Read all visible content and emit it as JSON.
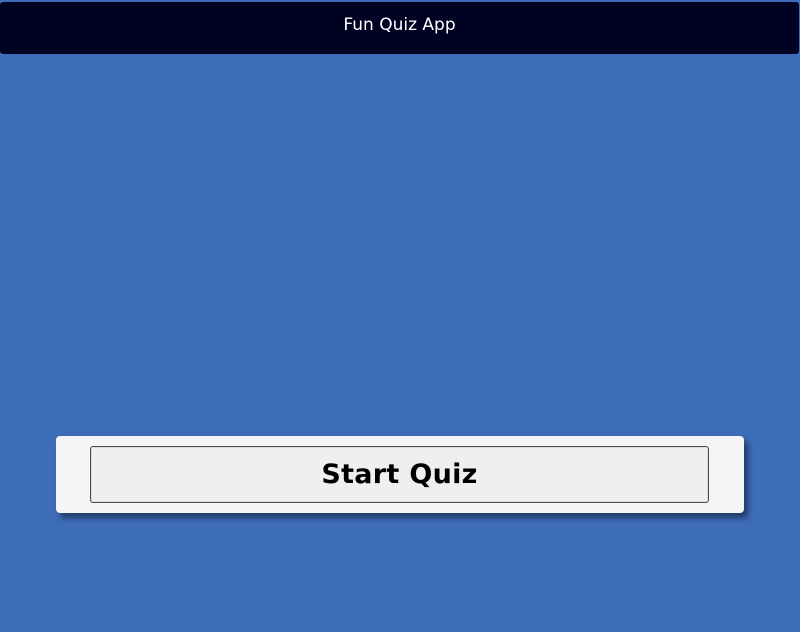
{
  "header": {
    "title": "Fun Quiz App"
  },
  "start_panel": {
    "button_label": "Start Quiz"
  },
  "colors": {
    "page_background": "#3d6cb9",
    "header_background": "#000222",
    "header_text": "#ffffff",
    "panel_background": "#f5f5f5",
    "button_background": "#efefef",
    "button_text": "#000000"
  }
}
